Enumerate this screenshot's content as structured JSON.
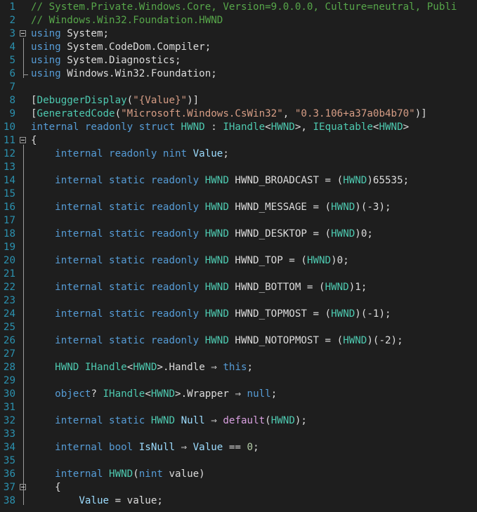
{
  "editor": {
    "lines": [
      {
        "n": "1",
        "tokens": [
          {
            "t": "// System.Private.Windows.Core, Version=9.0.0.0, Culture=neutral, Publi",
            "c": "cm"
          }
        ]
      },
      {
        "n": "2",
        "tokens": [
          {
            "t": "// Windows.Win32.Foundation.HWND",
            "c": "cm"
          }
        ]
      },
      {
        "n": "3",
        "fold": true,
        "tokens": [
          {
            "t": "using",
            "c": "kw"
          },
          {
            "t": " System;",
            "c": "pl"
          }
        ]
      },
      {
        "n": "4",
        "tokens": [
          {
            "t": "using",
            "c": "kw"
          },
          {
            "t": " System.CodeDom.Compiler;",
            "c": "pl"
          }
        ]
      },
      {
        "n": "5",
        "tokens": [
          {
            "t": "using",
            "c": "kw"
          },
          {
            "t": " System.Diagnostics;",
            "c": "pl"
          }
        ]
      },
      {
        "n": "6",
        "tokens": [
          {
            "t": "using",
            "c": "kw"
          },
          {
            "t": " Windows.Win32.Foundation;",
            "c": "pl"
          }
        ]
      },
      {
        "n": "7",
        "tokens": []
      },
      {
        "n": "8",
        "tokens": [
          {
            "t": "[",
            "c": "pl"
          },
          {
            "t": "DebuggerDisplay",
            "c": "ty"
          },
          {
            "t": "(",
            "c": "pl"
          },
          {
            "t": "\"{Value}\"",
            "c": "str"
          },
          {
            "t": ")]",
            "c": "pl"
          }
        ]
      },
      {
        "n": "9",
        "tokens": [
          {
            "t": "[",
            "c": "pl"
          },
          {
            "t": "GeneratedCode",
            "c": "ty"
          },
          {
            "t": "(",
            "c": "pl"
          },
          {
            "t": "\"Microsoft.Windows.CsWin32\"",
            "c": "str"
          },
          {
            "t": ", ",
            "c": "pl"
          },
          {
            "t": "\"0.3.106+a37a0b4b70\"",
            "c": "str"
          },
          {
            "t": ")]",
            "c": "pl"
          }
        ]
      },
      {
        "n": "10",
        "tokens": [
          {
            "t": "internal readonly struct ",
            "c": "kw"
          },
          {
            "t": "HWND",
            "c": "ty"
          },
          {
            "t": " : ",
            "c": "pl"
          },
          {
            "t": "IHandle",
            "c": "ty"
          },
          {
            "t": "<",
            "c": "pl"
          },
          {
            "t": "HWND",
            "c": "ty"
          },
          {
            "t": ">, ",
            "c": "pl"
          },
          {
            "t": "IEquatable",
            "c": "ty"
          },
          {
            "t": "<",
            "c": "pl"
          },
          {
            "t": "HWND",
            "c": "ty"
          },
          {
            "t": ">",
            "c": "pl"
          }
        ]
      },
      {
        "n": "11",
        "fold": true,
        "tokens": [
          {
            "t": "{",
            "c": "pl"
          }
        ]
      },
      {
        "n": "12",
        "tokens": [
          {
            "t": "    internal readonly nint ",
            "c": "kw"
          },
          {
            "t": "Value",
            "c": "param"
          },
          {
            "t": ";",
            "c": "pl"
          }
        ]
      },
      {
        "n": "13",
        "tokens": []
      },
      {
        "n": "14",
        "tokens": [
          {
            "t": "    internal static readonly ",
            "c": "kw"
          },
          {
            "t": "HWND",
            "c": "ty"
          },
          {
            "t": " HWND_BROADCAST = (",
            "c": "pl"
          },
          {
            "t": "HWND",
            "c": "ty"
          },
          {
            "t": ")65535;",
            "c": "pl"
          }
        ]
      },
      {
        "n": "15",
        "tokens": []
      },
      {
        "n": "16",
        "tokens": [
          {
            "t": "    internal static readonly ",
            "c": "kw"
          },
          {
            "t": "HWND",
            "c": "ty"
          },
          {
            "t": " HWND_MESSAGE = (",
            "c": "pl"
          },
          {
            "t": "HWND",
            "c": "ty"
          },
          {
            "t": ")(-3);",
            "c": "pl"
          }
        ]
      },
      {
        "n": "17",
        "tokens": []
      },
      {
        "n": "18",
        "tokens": [
          {
            "t": "    internal static readonly ",
            "c": "kw"
          },
          {
            "t": "HWND",
            "c": "ty"
          },
          {
            "t": " HWND_DESKTOP = (",
            "c": "pl"
          },
          {
            "t": "HWND",
            "c": "ty"
          },
          {
            "t": ")0;",
            "c": "pl"
          }
        ]
      },
      {
        "n": "19",
        "tokens": []
      },
      {
        "n": "20",
        "tokens": [
          {
            "t": "    internal static readonly ",
            "c": "kw"
          },
          {
            "t": "HWND",
            "c": "ty"
          },
          {
            "t": " HWND_TOP = (",
            "c": "pl"
          },
          {
            "t": "HWND",
            "c": "ty"
          },
          {
            "t": ")0;",
            "c": "pl"
          }
        ]
      },
      {
        "n": "21",
        "tokens": []
      },
      {
        "n": "22",
        "tokens": [
          {
            "t": "    internal static readonly ",
            "c": "kw"
          },
          {
            "t": "HWND",
            "c": "ty"
          },
          {
            "t": " HWND_BOTTOM = (",
            "c": "pl"
          },
          {
            "t": "HWND",
            "c": "ty"
          },
          {
            "t": ")1;",
            "c": "pl"
          }
        ]
      },
      {
        "n": "23",
        "tokens": []
      },
      {
        "n": "24",
        "tokens": [
          {
            "t": "    internal static readonly ",
            "c": "kw"
          },
          {
            "t": "HWND",
            "c": "ty"
          },
          {
            "t": " HWND_TOPMOST = (",
            "c": "pl"
          },
          {
            "t": "HWND",
            "c": "ty"
          },
          {
            "t": ")(-1);",
            "c": "pl"
          }
        ]
      },
      {
        "n": "25",
        "tokens": []
      },
      {
        "n": "26",
        "tokens": [
          {
            "t": "    internal static readonly ",
            "c": "kw"
          },
          {
            "t": "HWND",
            "c": "ty"
          },
          {
            "t": " HWND_NOTOPMOST = (",
            "c": "pl"
          },
          {
            "t": "HWND",
            "c": "ty"
          },
          {
            "t": ")(-2);",
            "c": "pl"
          }
        ]
      },
      {
        "n": "27",
        "tokens": []
      },
      {
        "n": "28",
        "tokens": [
          {
            "t": "    ",
            "c": "pl"
          },
          {
            "t": "HWND",
            "c": "ty"
          },
          {
            "t": " ",
            "c": "pl"
          },
          {
            "t": "IHandle",
            "c": "ty"
          },
          {
            "t": "<",
            "c": "pl"
          },
          {
            "t": "HWND",
            "c": "ty"
          },
          {
            "t": ">.Handle ⇒ ",
            "c": "pl"
          },
          {
            "t": "this",
            "c": "kw"
          },
          {
            "t": ";",
            "c": "pl"
          }
        ]
      },
      {
        "n": "29",
        "tokens": []
      },
      {
        "n": "30",
        "tokens": [
          {
            "t": "    ",
            "c": "pl"
          },
          {
            "t": "object",
            "c": "kw"
          },
          {
            "t": "? ",
            "c": "pl"
          },
          {
            "t": "IHandle",
            "c": "ty"
          },
          {
            "t": "<",
            "c": "pl"
          },
          {
            "t": "HWND",
            "c": "ty"
          },
          {
            "t": ">.Wrapper ⇒ ",
            "c": "pl"
          },
          {
            "t": "null",
            "c": "kw"
          },
          {
            "t": ";",
            "c": "pl"
          }
        ]
      },
      {
        "n": "31",
        "tokens": []
      },
      {
        "n": "32",
        "tokens": [
          {
            "t": "    internal static ",
            "c": "kw"
          },
          {
            "t": "HWND",
            "c": "ty"
          },
          {
            "t": " ",
            "c": "pl"
          },
          {
            "t": "Null",
            "c": "param"
          },
          {
            "t": " ⇒ ",
            "c": "pl"
          },
          {
            "t": "default",
            "c": "ctl"
          },
          {
            "t": "(",
            "c": "pl"
          },
          {
            "t": "HWND",
            "c": "ty"
          },
          {
            "t": ");",
            "c": "pl"
          }
        ]
      },
      {
        "n": "33",
        "tokens": []
      },
      {
        "n": "34",
        "tokens": [
          {
            "t": "    internal bool ",
            "c": "kw"
          },
          {
            "t": "IsNull",
            "c": "param"
          },
          {
            "t": " ⇒ ",
            "c": "pl"
          },
          {
            "t": "Value",
            "c": "param"
          },
          {
            "t": " == ",
            "c": "pl"
          },
          {
            "t": "0",
            "c": "num"
          },
          {
            "t": ";",
            "c": "pl"
          }
        ]
      },
      {
        "n": "35",
        "tokens": []
      },
      {
        "n": "36",
        "tokens": [
          {
            "t": "    internal ",
            "c": "kw"
          },
          {
            "t": "HWND",
            "c": "ty"
          },
          {
            "t": "(",
            "c": "pl"
          },
          {
            "t": "nint",
            "c": "kw"
          },
          {
            "t": " value)",
            "c": "pl"
          }
        ]
      },
      {
        "n": "37",
        "fold": true,
        "tokens": [
          {
            "t": "    {",
            "c": "pl"
          }
        ]
      },
      {
        "n": "38",
        "tokens": [
          {
            "t": "        ",
            "c": "pl"
          },
          {
            "t": "Value",
            "c": "param"
          },
          {
            "t": " = value;",
            "c": "pl"
          }
        ]
      }
    ]
  }
}
